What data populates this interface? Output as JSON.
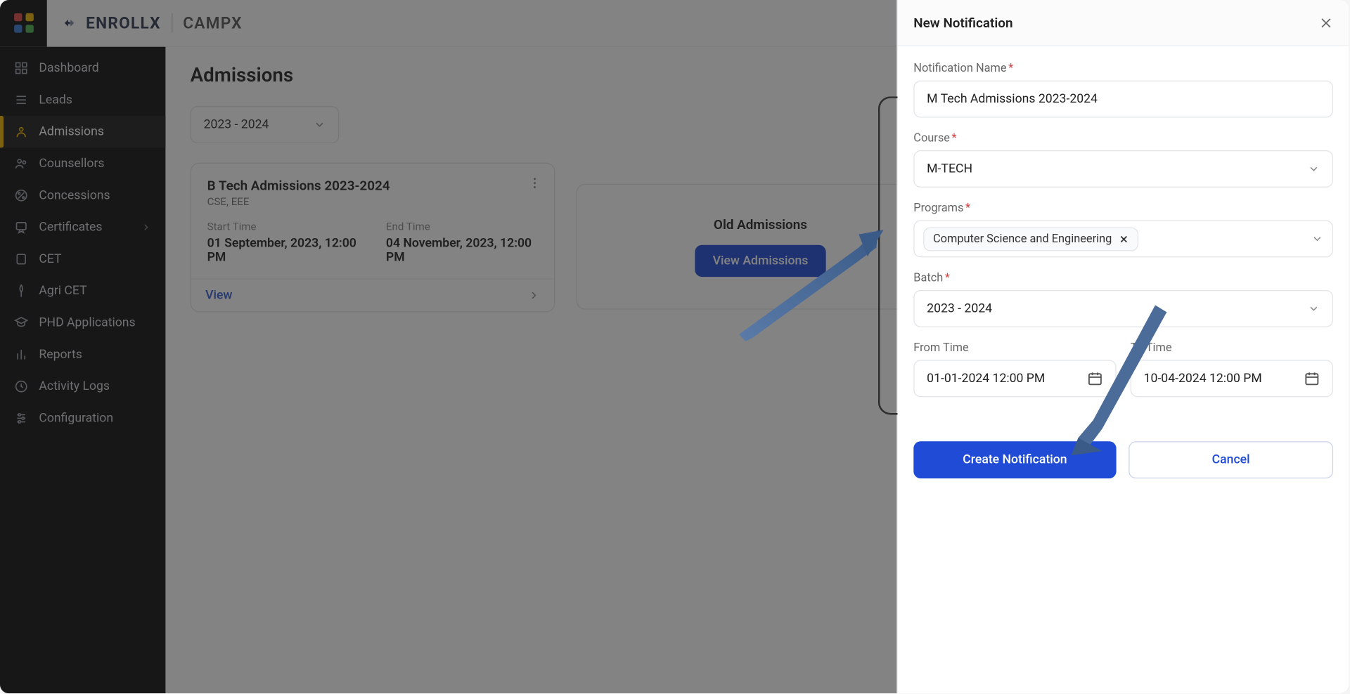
{
  "brand": {
    "part1": "ENROLLX",
    "part2": "CAMPX"
  },
  "sidebar": {
    "items": [
      {
        "label": "Dashboard"
      },
      {
        "label": "Leads"
      },
      {
        "label": "Admissions",
        "active": true
      },
      {
        "label": "Counsellors"
      },
      {
        "label": "Concessions"
      },
      {
        "label": "Certificates",
        "hasSub": true
      },
      {
        "label": "CET"
      },
      {
        "label": "Agri CET"
      },
      {
        "label": "PHD Applications"
      },
      {
        "label": "Reports"
      },
      {
        "label": "Activity Logs"
      },
      {
        "label": "Configuration"
      }
    ]
  },
  "page": {
    "title": "Admissions",
    "year_selected": "2023 - 2024"
  },
  "admission_card": {
    "title": "B Tech Admissions 2023-2024",
    "subtitle": "CSE, EEE",
    "start_label": "Start Time",
    "start_value": "01 September, 2023, 12:00 PM",
    "end_label": "End Time",
    "end_value": "04 November, 2023, 12:00 PM",
    "view_label": "View"
  },
  "old_card": {
    "title": "Old Admissions",
    "button": "View Admissions"
  },
  "drawer": {
    "title": "New Notification",
    "name_label": "Notification Name",
    "name_value": "M Tech Admissions 2023-2024",
    "course_label": "Course",
    "course_value": "M-TECH",
    "programs_label": "Programs",
    "programs_chip": "Computer Science and Engineering",
    "batch_label": "Batch",
    "batch_value": "2023 - 2024",
    "from_label": "From Time",
    "from_value": "01-01-2024 12:00 PM",
    "to_label": "To Time",
    "to_value": "10-04-2024 12:00 PM",
    "create_button": "Create Notification",
    "cancel_button": "Cancel"
  }
}
